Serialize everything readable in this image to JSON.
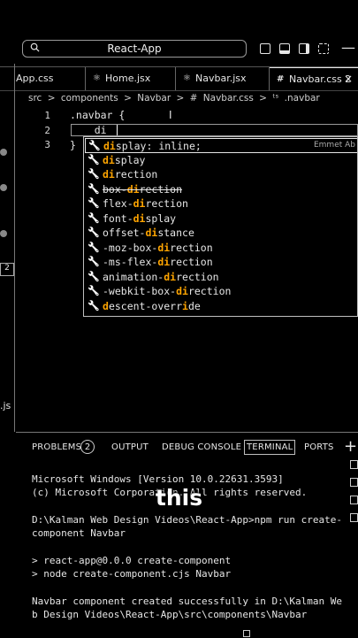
{
  "window": {
    "title": "React-App"
  },
  "tabs": [
    {
      "label": "App.css",
      "icon": "#"
    },
    {
      "label": "Home.jsx",
      "icon": "⚛"
    },
    {
      "label": "Navbar.jsx",
      "icon": "⚛"
    },
    {
      "label": "Navbar.css 2",
      "icon": "#",
      "close": "×"
    }
  ],
  "breadcrumb": [
    "src",
    ">",
    "components",
    ">",
    "Navbar",
    ">",
    "#",
    "Navbar.css",
    ">",
    "ᵗˢ",
    ".navbar"
  ],
  "editor": {
    "lines": [
      {
        "number": "1",
        "text": ".navbar {"
      },
      {
        "number": "2",
        "text": "    di"
      },
      {
        "number": "3",
        "text": "}"
      }
    ]
  },
  "suggestions": {
    "items": [
      {
        "pre": "",
        "hl": "di",
        "post": "splay: inline;",
        "detail": "Emmet Ab"
      },
      {
        "pre": "",
        "hl": "di",
        "post": "splay"
      },
      {
        "pre": "",
        "hl": "di",
        "post": "rection"
      },
      {
        "pre": "box-",
        "hl": "di",
        "post": "rection",
        "deprecated": true
      },
      {
        "pre": "flex-",
        "hl": "di",
        "post": "rection"
      },
      {
        "pre": "font-",
        "hl": "di",
        "post": "splay"
      },
      {
        "pre": "offset-",
        "hl": "di",
        "post": "stance"
      },
      {
        "pre": "-moz-box-",
        "hl": "di",
        "post": "rection"
      },
      {
        "pre": "-ms-flex-",
        "hl": "di",
        "post": "rection"
      },
      {
        "pre": "animation-",
        "hl": "di",
        "post": "rection"
      },
      {
        "pre": "-webkit-box-",
        "hl": "di",
        "post": "rection"
      },
      {
        "pre": "",
        "hl": "d",
        "post": "escent-overr",
        "hl2": "i",
        "post2": "de"
      }
    ]
  },
  "panel": {
    "tabs": [
      "PROBLEMS",
      "OUTPUT",
      "DEBUG CONSOLE",
      "TERMINAL",
      "PORTS"
    ],
    "problems_count": "2",
    "plus": "+"
  },
  "terminal": {
    "lines": [
      "Microsoft Windows [Version 10.0.22631.3593]",
      "(c) Microsoft Corporation. All rights reserved.",
      "",
      "D:\\Kalman Web Design Videos\\React-App>npm run create-",
      "component Navbar",
      "",
      "> react-app@0.0.0 create-component",
      "> node create-component.cjs Navbar",
      "",
      "Navbar component created successfully in D:\\Kalman We",
      "b Design Videos\\React-App\\src\\components\\Navbar"
    ]
  },
  "caption": "this",
  "sidebar_fragment": ".js",
  "sidebar_badge": "2",
  "colors": {
    "highlight": "#ffa500",
    "background": "#000000"
  }
}
